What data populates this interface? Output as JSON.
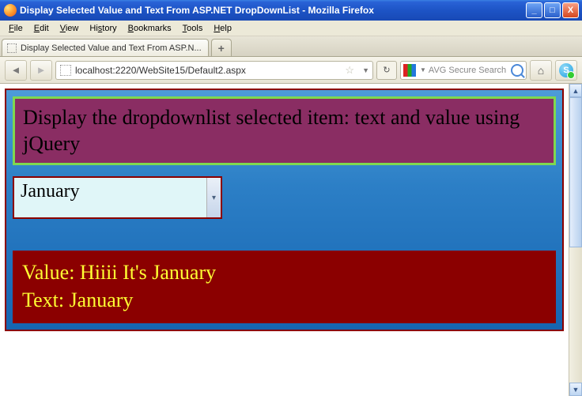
{
  "window": {
    "title": "Display Selected Value and Text From ASP.NET DropDownList - Mozilla Firefox"
  },
  "menu": {
    "items": [
      "File",
      "Edit",
      "View",
      "History",
      "Bookmarks",
      "Tools",
      "Help"
    ]
  },
  "tab": {
    "label": "Display Selected Value and Text From ASP.N..."
  },
  "address": {
    "url": "localhost:2220/WebSite15/Default2.aspx"
  },
  "search": {
    "placeholder": "AVG Secure Search"
  },
  "page": {
    "heading": "Display the dropdownlist selected item: text and value using jQuery",
    "dropdown": {
      "selected": "January"
    },
    "result": {
      "value_label": "Value:",
      "value": "Hiiii It's January",
      "text_label": "Text:",
      "text": "January"
    }
  }
}
